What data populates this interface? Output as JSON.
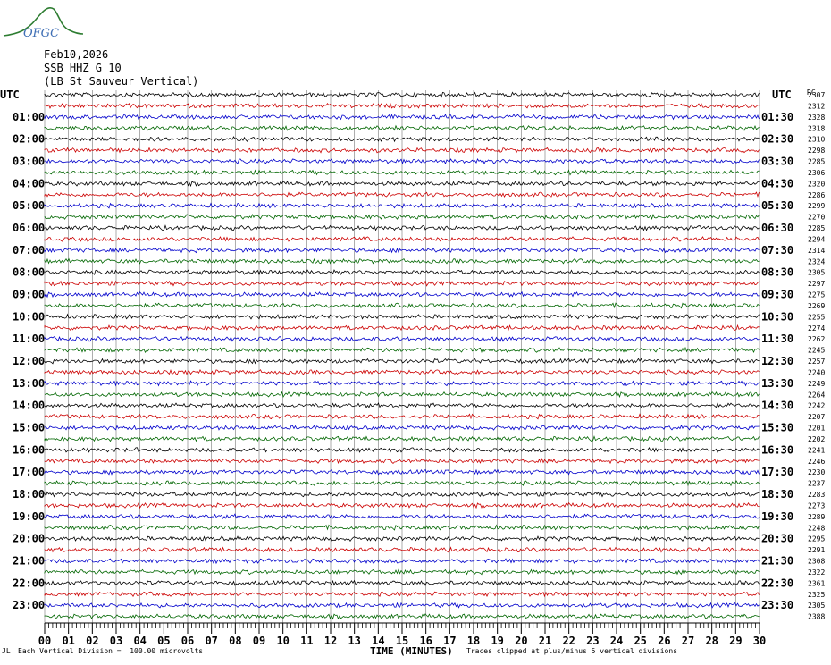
{
  "logo": {
    "text": "OFGC",
    "color": "#2e7d32",
    "text_color": "#3f6fb5"
  },
  "header": {
    "date": "Feb10,2026",
    "station": "SSB HHZ G 10",
    "location": "(LB St Sauveur Vertical)"
  },
  "footer": {
    "tiny_mark": "JL",
    "scale_note": "Each Vertical Division =  100.00 microvolts",
    "clip_note": "Traces clipped at plus/minus 5 vertical divisions"
  },
  "chart_data": {
    "type": "line",
    "subtype": "helicorder",
    "xlabel": "TIME (MINUTES)",
    "xlim": [
      0,
      30
    ],
    "x_ticks": [
      "00",
      "01",
      "02",
      "03",
      "04",
      "05",
      "06",
      "07",
      "08",
      "09",
      "10",
      "11",
      "12",
      "13",
      "14",
      "15",
      "16",
      "17",
      "18",
      "19",
      "20",
      "21",
      "22",
      "23",
      "24",
      "25",
      "26",
      "27",
      "28",
      "29",
      "30"
    ],
    "left_axis_title": "UTC",
    "right_axis_title": "UTC",
    "right_corner_label": "RC",
    "left_labels": [
      "01:00",
      "02:00",
      "03:00",
      "04:00",
      "05:00",
      "06:00",
      "07:00",
      "08:00",
      "09:00",
      "10:00",
      "11:00",
      "12:00",
      "13:00",
      "14:00",
      "15:00",
      "16:00",
      "17:00",
      "18:00",
      "19:00",
      "20:00",
      "21:00",
      "22:00",
      "23:00"
    ],
    "right_labels": [
      "01:30",
      "02:30",
      "03:30",
      "04:30",
      "05:30",
      "06:30",
      "07:30",
      "08:30",
      "09:30",
      "10:30",
      "11:30",
      "12:30",
      "13:30",
      "14:30",
      "15:30",
      "16:30",
      "17:30",
      "18:30",
      "19:30",
      "20:30",
      "21:30",
      "22:30",
      "23:30"
    ],
    "trace_colors": [
      "#000000",
      "#cc0000",
      "#0000cc",
      "#006600"
    ],
    "trace_count": 48,
    "trace_values": [
      2307,
      2312,
      2328,
      2318,
      2310,
      2298,
      2285,
      2306,
      2320,
      2286,
      2299,
      2270,
      2285,
      2294,
      2314,
      2324,
      2305,
      2297,
      2275,
      2269,
      2255,
      2274,
      2262,
      2245,
      2257,
      2240,
      2249,
      2264,
      2242,
      2207,
      2201,
      2202,
      2241,
      2246,
      2230,
      2237,
      2283,
      2273,
      2289,
      2248,
      2295,
      2291,
      2308,
      2322,
      2361,
      2325,
      2305,
      2388
    ],
    "grid": true,
    "gridline_color": "#888888"
  }
}
